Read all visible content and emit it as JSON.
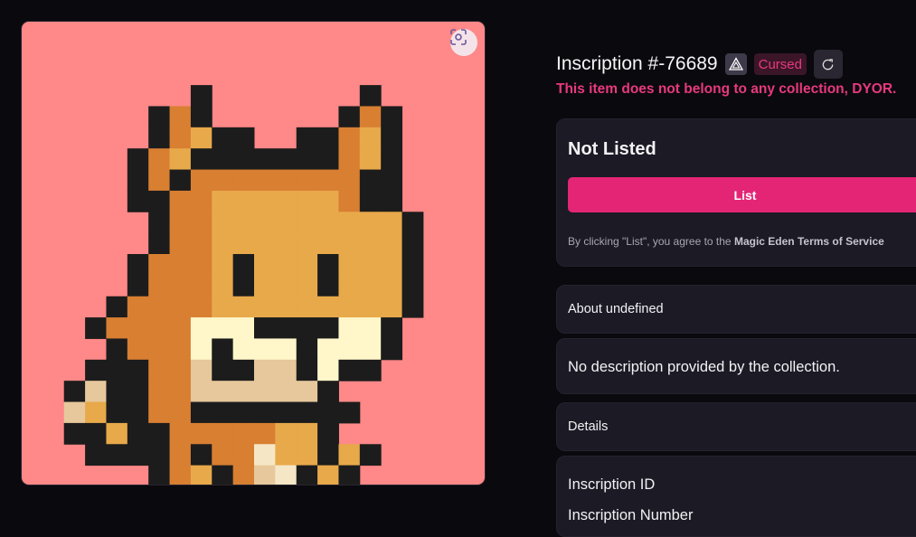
{
  "artwork": {
    "background": "#ff8888",
    "fullscreen_icon": "scan-icon",
    "grid_cells": 22,
    "palette": {
      "K": "#1c1c1c",
      "O": "#d87f32",
      "Y": "#e8a94a",
      "C": "#fff7c9",
      "T": "#e6c89c",
      "L": "#f5e7c6"
    },
    "rows": [
      "......................",
      "......................",
      "......................",
      "........K.......K.....",
      "......KOK......KOK....",
      "......KOYKK..KKOYK....",
      ".....KOYKKKKKKKOYK....",
      ".....KOKOOOOOOOOKK....",
      ".....KKOOYYYYYYOKK....",
      "......KOOYYYYYYYYYK...",
      "......KOOYYYYYYYYYK...",
      ".....KOOOYKYYYKYYYK...",
      ".....KOOOYKYYYKYYYK...",
      "....KOOOOYYYYYYYYYK...",
      "...KOOOOCCCKKKKCCK....",
      "....KOOOCKCCCKCCCK....",
      "...KKKOOTKKTTKCKK.....",
      "..KTKKOOTTTTTTK.......",
      "..TYKKOOKKKKKKKK......",
      "..KKYKKOOOOOYYK.......",
      "...KKKKOKOOLYYKYK.....",
      "......KOYKOTLKYK......",
      "......KOKYKTLLKKY....."
    ]
  },
  "header": {
    "title": "Inscription #-76689",
    "badge_icon": "ordinals-triangle-icon",
    "cursed_label": "Cursed",
    "refresh_icon": "refresh-icon",
    "warning": "This item does not belong to any collection, DYOR."
  },
  "listing": {
    "status": "Not Listed",
    "button_label": "List",
    "terms_prefix": "By clicking \"List\", you agree to the",
    "terms_link": "Magic Eden Terms of Service"
  },
  "about": {
    "label": "About undefined"
  },
  "description": {
    "text": "No description provided by the collection."
  },
  "details": {
    "label": "Details"
  },
  "info": {
    "row1": "Inscription ID",
    "row2": "Inscription Number"
  },
  "colors": {
    "accent": "#e42575",
    "warning": "#e8397f",
    "panel": "#1c1a24",
    "page": "#0a090e"
  }
}
